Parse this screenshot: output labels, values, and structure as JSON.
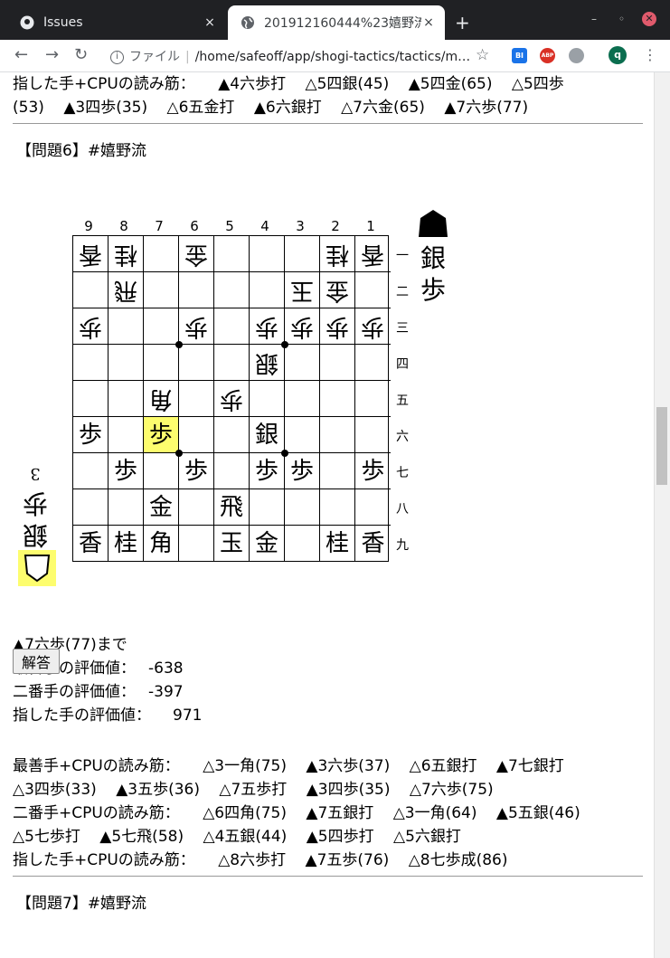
{
  "browser": {
    "tabs": [
      {
        "label": "Issues",
        "close": "×"
      },
      {
        "label": "201912160444%23嬉野流",
        "close": "×"
      }
    ],
    "new_tab": "+",
    "win_min": "–",
    "win_max": "◦",
    "win_close": "✕",
    "address_label": "ファイル",
    "address_url": "/home/safeoff/app/shogi-tactics/tactics/m…",
    "avatar": "q",
    "ext_bi": "BI",
    "ext_abp": "ABP"
  },
  "prev": {
    "line1_label": "指した手+CPUの読み筋：",
    "line1_moves": [
      "▲4六歩打",
      "△5四銀(45)",
      "▲5四金(65)",
      "△5四歩"
    ],
    "line2_moves": [
      "(53)",
      "▲3四歩(35)",
      "△6五金打",
      "▲6六銀打",
      "△7六金(65)",
      "▲7六歩(77)"
    ]
  },
  "problem": {
    "title": "【問題6】#嬉野流",
    "col_labels": [
      "9",
      "8",
      "7",
      "6",
      "5",
      "4",
      "3",
      "2",
      "1"
    ],
    "row_labels": [
      "一",
      "二",
      "三",
      "四",
      "五",
      "六",
      "七",
      "八",
      "九"
    ],
    "board": [
      [
        "v香",
        "v桂",
        "",
        "v金",
        "",
        "",
        "",
        "v桂",
        "v香"
      ],
      [
        "",
        "v飛",
        "",
        "",
        "",
        "",
        "v玉",
        "v金",
        ""
      ],
      [
        "v歩",
        "",
        "",
        "v歩",
        "",
        "v歩",
        "v歩",
        "v歩",
        "v歩"
      ],
      [
        "",
        "",
        "",
        "",
        "",
        "v銀",
        "",
        "",
        ""
      ],
      [
        "",
        "",
        "v角",
        "",
        "v歩",
        "",
        "",
        "",
        ""
      ],
      [
        "歩",
        "",
        "歩",
        "",
        "",
        "銀",
        "",
        "",
        ""
      ],
      [
        "",
        "歩",
        "",
        "歩",
        "",
        "歩",
        "歩",
        "",
        "歩"
      ],
      [
        "",
        "",
        "金",
        "",
        "飛",
        "",
        "",
        "",
        ""
      ],
      [
        "香",
        "桂",
        "角",
        "",
        "玉",
        "金",
        "",
        "桂",
        "香"
      ]
    ],
    "highlight": {
      "row": 5,
      "col": 2
    },
    "gote_hand": [
      "銀",
      "歩"
    ],
    "sente_hand": [
      "銀",
      "歩",
      "3"
    ],
    "last_move": "▲7六歩(77)まで",
    "best_eval_label": "最善手の評価値：",
    "best_eval": "-638",
    "second_eval_label": "二番手の評価値：",
    "second_eval": "-397",
    "played_eval_label": "指した手の評価値：",
    "played_eval": "971",
    "answer_button": "解答",
    "best_pv_label": "最善手+CPUの読み筋：",
    "best_pv_1": [
      "△3一角(75)",
      "▲3六歩(37)",
      "△6五銀打",
      "▲7七銀打"
    ],
    "best_pv_2": [
      "△3四歩(33)",
      "▲3五歩(36)",
      "△7五歩打",
      "▲3四歩(35)",
      "△7六歩(75)"
    ],
    "second_pv_label": "二番手+CPUの読み筋：",
    "second_pv_1": [
      "△6四角(75)",
      "▲7五銀打",
      "△3一角(64)",
      "▲5五銀(46)"
    ],
    "second_pv_2": [
      "△5七歩打",
      "▲5七飛(58)",
      "△4五銀(44)",
      "▲5四歩打",
      "△5六銀打"
    ],
    "played_pv_label": "指した手+CPUの読み筋：",
    "played_pv_1": [
      "△8六歩打",
      "▲7五歩(76)",
      "△8七歩成(86)"
    ]
  },
  "next_title": "【問題7】#嬉野流"
}
